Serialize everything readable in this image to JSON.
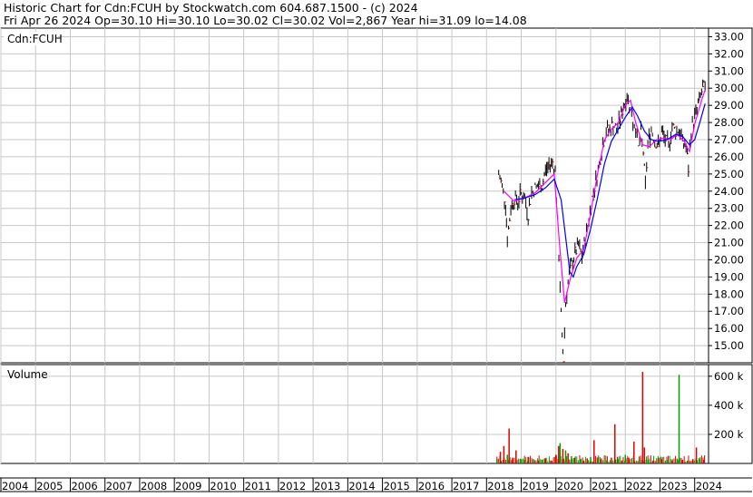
{
  "header": {
    "line1": "Historic Chart for Cdn:FCUH by Stockwatch.com 604.687.1500 - (c) 2024",
    "line2": "Fri Apr 26 2024   Op=30.10   Hi=30.10   Lo=30.02   Cl=30.02   Vol=2,867   Year hi=31.09   lo=14.08"
  },
  "colors": {
    "background": "#ffffff",
    "grid": "#c8c8c8",
    "price_bar": "#000000",
    "ma_short": "#ff00ff",
    "ma_long": "#0000ff",
    "volume_up": "#00a000",
    "volume_down": "#e00000"
  },
  "chart_data": [
    {
      "type": "line",
      "title": "Cdn:FCUH",
      "ylim": [
        14,
        33.5
      ],
      "ytick_labels": [
        "15.00",
        "16.00",
        "17.00",
        "18.00",
        "19.00",
        "20.00",
        "21.00",
        "22.00",
        "23.00",
        "24.00",
        "25.00",
        "26.00",
        "27.00",
        "28.00",
        "29.00",
        "30.00",
        "31.00",
        "32.00",
        "33.00"
      ],
      "x_year_range": [
        2004,
        2024.4
      ],
      "series": [
        {
          "name": "",
          "kind": "price",
          "points": [
            [
              2018.35,
              25.0
            ],
            [
              2018.45,
              24.3
            ],
            [
              2018.55,
              23.3
            ],
            [
              2018.6,
              21.2
            ],
            [
              2018.7,
              23.0
            ],
            [
              2018.8,
              23.6
            ],
            [
              2018.9,
              23.4
            ],
            [
              2019.0,
              23.9
            ],
            [
              2019.1,
              23.6
            ],
            [
              2019.2,
              22.7
            ],
            [
              2019.3,
              23.9
            ],
            [
              2019.4,
              24.2
            ],
            [
              2019.5,
              24.3
            ],
            [
              2019.6,
              24.3
            ],
            [
              2019.7,
              25.2
            ],
            [
              2019.8,
              25.5
            ],
            [
              2019.9,
              25.7
            ],
            [
              2019.98,
              25.3
            ],
            [
              2020.05,
              22.0
            ],
            [
              2020.12,
              18.5
            ],
            [
              2020.18,
              15.2
            ],
            [
              2020.22,
              14.2
            ],
            [
              2020.28,
              17.5
            ],
            [
              2020.35,
              18.7
            ],
            [
              2020.45,
              19.7
            ],
            [
              2020.55,
              20.4
            ],
            [
              2020.65,
              20.8
            ],
            [
              2020.75,
              20.2
            ],
            [
              2020.85,
              21.2
            ],
            [
              2020.95,
              22.4
            ],
            [
              2021.05,
              23.6
            ],
            [
              2021.15,
              24.6
            ],
            [
              2021.25,
              25.6
            ],
            [
              2021.35,
              26.7
            ],
            [
              2021.45,
              27.5
            ],
            [
              2021.55,
              27.6
            ],
            [
              2021.65,
              27.9
            ],
            [
              2021.75,
              27.5
            ],
            [
              2021.85,
              28.2
            ],
            [
              2021.95,
              29.0
            ],
            [
              2022.05,
              29.5
            ],
            [
              2022.15,
              29.0
            ],
            [
              2022.22,
              28.0
            ],
            [
              2022.3,
              27.8
            ],
            [
              2022.38,
              26.5
            ],
            [
              2022.45,
              27.3
            ],
            [
              2022.52,
              26.3
            ],
            [
              2022.58,
              24.2
            ],
            [
              2022.65,
              26.8
            ],
            [
              2022.75,
              27.6
            ],
            [
              2022.85,
              27.0
            ],
            [
              2022.95,
              26.6
            ],
            [
              2023.05,
              27.4
            ],
            [
              2023.15,
              27.0
            ],
            [
              2023.25,
              26.6
            ],
            [
              2023.35,
              27.8
            ],
            [
              2023.45,
              27.5
            ],
            [
              2023.55,
              27.6
            ],
            [
              2023.65,
              26.9
            ],
            [
              2023.75,
              26.6
            ],
            [
              2023.82,
              25.3
            ],
            [
              2023.9,
              27.6
            ],
            [
              2024.0,
              28.3
            ],
            [
              2024.1,
              29.0
            ],
            [
              2024.2,
              29.8
            ],
            [
              2024.3,
              30.1
            ]
          ]
        },
        {
          "name": "",
          "kind": "moving_average_short",
          "points": [
            [
              2018.5,
              24.0
            ],
            [
              2018.8,
              23.4
            ],
            [
              2019.1,
              23.6
            ],
            [
              2019.4,
              23.9
            ],
            [
              2019.7,
              24.5
            ],
            [
              2019.95,
              25.0
            ],
            [
              2020.1,
              21.0
            ],
            [
              2020.25,
              17.5
            ],
            [
              2020.4,
              18.8
            ],
            [
              2020.6,
              20.1
            ],
            [
              2020.8,
              20.6
            ],
            [
              2021.0,
              22.7
            ],
            [
              2021.2,
              25.0
            ],
            [
              2021.4,
              27.0
            ],
            [
              2021.6,
              27.6
            ],
            [
              2021.8,
              28.0
            ],
            [
              2022.0,
              29.0
            ],
            [
              2022.15,
              29.3
            ],
            [
              2022.3,
              28.0
            ],
            [
              2022.5,
              26.7
            ],
            [
              2022.7,
              26.6
            ],
            [
              2022.9,
              27.0
            ],
            [
              2023.1,
              27.1
            ],
            [
              2023.3,
              27.0
            ],
            [
              2023.5,
              27.3
            ],
            [
              2023.7,
              26.9
            ],
            [
              2023.85,
              26.3
            ],
            [
              2024.0,
              27.9
            ],
            [
              2024.2,
              29.3
            ],
            [
              2024.3,
              29.9
            ]
          ]
        },
        {
          "name": "",
          "kind": "moving_average_long",
          "points": [
            [
              2018.8,
              23.5
            ],
            [
              2019.1,
              23.6
            ],
            [
              2019.4,
              23.8
            ],
            [
              2019.7,
              24.2
            ],
            [
              2019.95,
              24.7
            ],
            [
              2020.15,
              23.5
            ],
            [
              2020.3,
              21.0
            ],
            [
              2020.4,
              19.3
            ],
            [
              2020.5,
              19.0
            ],
            [
              2020.6,
              19.6
            ],
            [
              2020.8,
              20.3
            ],
            [
              2021.0,
              21.8
            ],
            [
              2021.2,
              23.6
            ],
            [
              2021.4,
              25.6
            ],
            [
              2021.6,
              26.9
            ],
            [
              2021.8,
              27.6
            ],
            [
              2022.0,
              28.3
            ],
            [
              2022.2,
              28.9
            ],
            [
              2022.35,
              28.4
            ],
            [
              2022.55,
              27.5
            ],
            [
              2022.75,
              27.0
            ],
            [
              2022.95,
              26.9
            ],
            [
              2023.2,
              27.0
            ],
            [
              2023.45,
              27.3
            ],
            [
              2023.65,
              27.2
            ],
            [
              2023.85,
              26.7
            ],
            [
              2024.0,
              27.0
            ],
            [
              2024.15,
              28.0
            ],
            [
              2024.3,
              29.1
            ]
          ]
        }
      ]
    },
    {
      "type": "bar",
      "title": "Volume",
      "ylim": [
        0,
        680000
      ],
      "ytick_labels": [
        "200 k",
        "400 k",
        "600 k"
      ],
      "xtick_labels": [
        "2004",
        "2005",
        "2006",
        "2007",
        "2008",
        "2009",
        "2010",
        "2011",
        "2012",
        "2013",
        "2014",
        "2015",
        "2016",
        "2017",
        "2018",
        "2019",
        "2020",
        "2021",
        "2022",
        "2023",
        "2024"
      ],
      "series": [
        {
          "name": "",
          "points": [
            [
              2018.3,
              30000,
              "up"
            ],
            [
              2018.4,
              80000,
              "down"
            ],
            [
              2018.5,
              120000,
              "down"
            ],
            [
              2018.6,
              60000,
              "up"
            ],
            [
              2018.65,
              240000,
              "down"
            ],
            [
              2018.75,
              40000,
              "down"
            ],
            [
              2018.85,
              90000,
              "down"
            ],
            [
              2019.0,
              30000,
              "up"
            ],
            [
              2019.1,
              25000,
              "down"
            ],
            [
              2019.2,
              45000,
              "down"
            ],
            [
              2019.35,
              30000,
              "up"
            ],
            [
              2019.5,
              20000,
              "down"
            ],
            [
              2019.6,
              25000,
              "up"
            ],
            [
              2019.7,
              35000,
              "down"
            ],
            [
              2019.85,
              20000,
              "down"
            ],
            [
              2020.0,
              60000,
              "down"
            ],
            [
              2020.08,
              120000,
              "down"
            ],
            [
              2020.12,
              140000,
              "up"
            ],
            [
              2020.2,
              100000,
              "down"
            ],
            [
              2020.28,
              90000,
              "up"
            ],
            [
              2020.35,
              70000,
              "down"
            ],
            [
              2020.45,
              50000,
              "up"
            ],
            [
              2020.55,
              40000,
              "down"
            ],
            [
              2020.7,
              30000,
              "up"
            ],
            [
              2020.8,
              20000,
              "down"
            ],
            [
              2020.9,
              35000,
              "down"
            ],
            [
              2021.0,
              45000,
              "up"
            ],
            [
              2021.1,
              160000,
              "down"
            ],
            [
              2021.2,
              40000,
              "up"
            ],
            [
              2021.3,
              30000,
              "down"
            ],
            [
              2021.45,
              20000,
              "up"
            ],
            [
              2021.6,
              40000,
              "down"
            ],
            [
              2021.7,
              270000,
              "down"
            ],
            [
              2021.8,
              30000,
              "up"
            ],
            [
              2021.9,
              20000,
              "down"
            ],
            [
              2022.0,
              60000,
              "up"
            ],
            [
              2022.1,
              40000,
              "down"
            ],
            [
              2022.25,
              150000,
              "down"
            ],
            [
              2022.4,
              30000,
              "up"
            ],
            [
              2022.5,
              630000,
              "down"
            ],
            [
              2022.55,
              110000,
              "down"
            ],
            [
              2022.65,
              25000,
              "up"
            ],
            [
              2022.8,
              20000,
              "down"
            ],
            [
              2022.95,
              40000,
              "up"
            ],
            [
              2023.05,
              30000,
              "down"
            ],
            [
              2023.2,
              25000,
              "up"
            ],
            [
              2023.35,
              20000,
              "down"
            ],
            [
              2023.5,
              30000,
              "up"
            ],
            [
              2023.55,
              610000,
              "up"
            ],
            [
              2023.65,
              25000,
              "down"
            ],
            [
              2023.8,
              20000,
              "up"
            ],
            [
              2023.95,
              30000,
              "down"
            ],
            [
              2024.05,
              110000,
              "down"
            ],
            [
              2024.15,
              30000,
              "up"
            ],
            [
              2024.25,
              25000,
              "down"
            ]
          ]
        }
      ]
    }
  ]
}
